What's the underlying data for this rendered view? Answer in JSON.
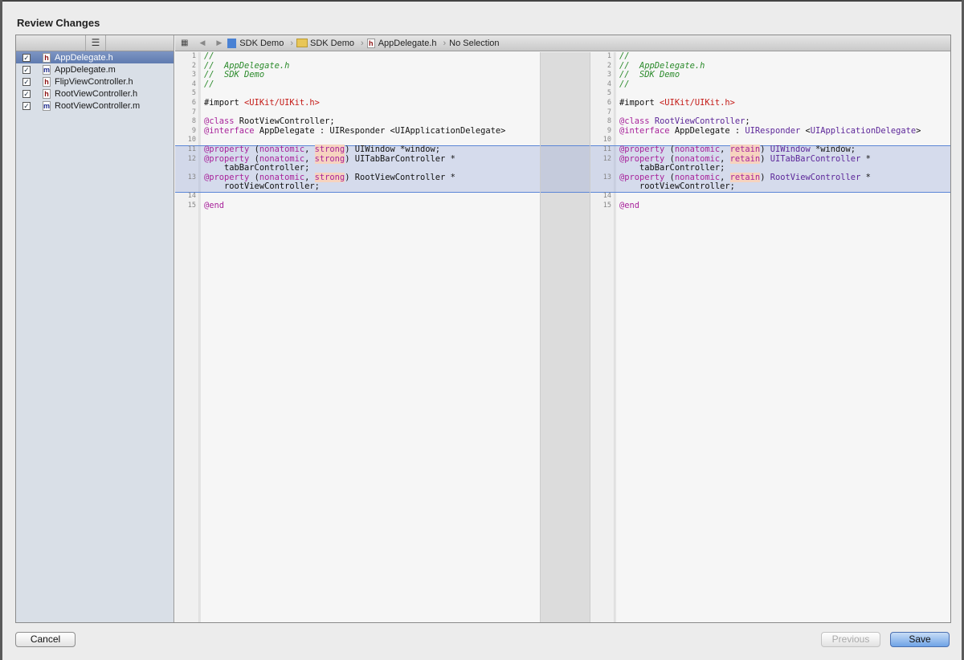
{
  "title": "Review Changes",
  "sidebar": {
    "menu_icon": "list-icon",
    "files": [
      {
        "name": "AppDelegate.h",
        "type": "h",
        "checked": true,
        "selected": true
      },
      {
        "name": "AppDelegate.m",
        "type": "m",
        "checked": true
      },
      {
        "name": "FlipViewController.h",
        "type": "h",
        "checked": true
      },
      {
        "name": "RootViewController.h",
        "type": "h",
        "checked": true
      },
      {
        "name": "RootViewController.m",
        "type": "m",
        "checked": true
      }
    ]
  },
  "jumpbar": {
    "items": [
      "SDK Demo",
      "SDK Demo",
      "AppDelegate.h",
      "No Selection"
    ]
  },
  "colors": {
    "comment": "#2a8a2a",
    "keyword": "#a8239b",
    "string": "#c41a16",
    "class": "#5c2699",
    "change": "#f6d3bf",
    "highlight_border": "#5b86d6"
  },
  "changed_lines": [
    11,
    12,
    13
  ],
  "left": [
    {
      "n": "1",
      "t": [
        [
          "//",
          "cm"
        ]
      ]
    },
    {
      "n": "2",
      "t": [
        [
          "//  AppDelegate.h",
          "cm"
        ]
      ]
    },
    {
      "n": "3",
      "t": [
        [
          "//  SDK Demo",
          "cm"
        ]
      ]
    },
    {
      "n": "4",
      "t": [
        [
          "//",
          "cm"
        ]
      ]
    },
    {
      "n": "5",
      "t": []
    },
    {
      "n": "6",
      "t": [
        [
          "#import ",
          "pl"
        ],
        [
          "<UIKit/UIKit.h>",
          "st"
        ]
      ]
    },
    {
      "n": "7",
      "t": []
    },
    {
      "n": "8",
      "t": [
        [
          "@class",
          "kw"
        ],
        [
          " RootViewController;",
          "pl"
        ]
      ]
    },
    {
      "n": "9",
      "t": [
        [
          "@interface",
          "kw"
        ],
        [
          " AppDelegate : UIResponder <UIApplicationDelegate>",
          "pl"
        ]
      ]
    },
    {
      "n": "10",
      "t": []
    },
    {
      "n": "11",
      "t": [
        [
          "@property",
          "kw"
        ],
        [
          " (",
          "pl"
        ],
        [
          "nonatomic",
          "kw"
        ],
        [
          ", ",
          "pl"
        ],
        [
          "strong",
          "ch"
        ],
        [
          ") UIWindow *window;",
          "pl"
        ]
      ]
    },
    {
      "n": "12",
      "t": [
        [
          "@property",
          "kw"
        ],
        [
          " (",
          "pl"
        ],
        [
          "nonatomic",
          "kw"
        ],
        [
          ", ",
          "pl"
        ],
        [
          "strong",
          "ch"
        ],
        [
          ") UITabBarController *",
          "pl"
        ]
      ]
    },
    {
      "n": "",
      "t": [
        [
          "    tabBarController;",
          "pl"
        ]
      ]
    },
    {
      "n": "13",
      "t": [
        [
          "@property",
          "kw"
        ],
        [
          " (",
          "pl"
        ],
        [
          "nonatomic",
          "kw"
        ],
        [
          ", ",
          "pl"
        ],
        [
          "strong",
          "ch"
        ],
        [
          ") RootViewController *",
          "pl"
        ]
      ]
    },
    {
      "n": "",
      "t": [
        [
          "    rootViewController;",
          "pl"
        ]
      ]
    },
    {
      "n": "14",
      "t": []
    },
    {
      "n": "15",
      "t": [
        [
          "@end",
          "kw"
        ]
      ]
    }
  ],
  "right": [
    {
      "n": "1",
      "t": [
        [
          "//",
          "cm"
        ]
      ]
    },
    {
      "n": "2",
      "t": [
        [
          "//  AppDelegate.h",
          "cm"
        ]
      ]
    },
    {
      "n": "3",
      "t": [
        [
          "//  SDK Demo",
          "cm"
        ]
      ]
    },
    {
      "n": "4",
      "t": [
        [
          "//",
          "cm"
        ]
      ]
    },
    {
      "n": "5",
      "t": []
    },
    {
      "n": "6",
      "t": [
        [
          "#import ",
          "pl"
        ],
        [
          "<UIKit/UIKit.h>",
          "st"
        ]
      ]
    },
    {
      "n": "7",
      "t": []
    },
    {
      "n": "8",
      "t": [
        [
          "@class",
          "kw"
        ],
        [
          " ",
          "pl"
        ],
        [
          "RootViewController",
          "cl"
        ],
        [
          ";",
          "pl"
        ]
      ]
    },
    {
      "n": "9",
      "t": [
        [
          "@interface",
          "kw"
        ],
        [
          " AppDelegate : ",
          "pl"
        ],
        [
          "UIResponder",
          "cl"
        ],
        [
          " <",
          "pl"
        ],
        [
          "UIApplicationDelegate",
          "cl"
        ],
        [
          ">",
          "pl"
        ]
      ]
    },
    {
      "n": "10",
      "t": []
    },
    {
      "n": "11",
      "t": [
        [
          "@property",
          "kw"
        ],
        [
          " (",
          "pl"
        ],
        [
          "nonatomic",
          "kw"
        ],
        [
          ", ",
          "pl"
        ],
        [
          "retain",
          "ch"
        ],
        [
          ") ",
          "pl"
        ],
        [
          "UIWindow",
          "cl"
        ],
        [
          " *window;",
          "pl"
        ]
      ]
    },
    {
      "n": "12",
      "t": [
        [
          "@property",
          "kw"
        ],
        [
          " (",
          "pl"
        ],
        [
          "nonatomic",
          "kw"
        ],
        [
          ", ",
          "pl"
        ],
        [
          "retain",
          "ch"
        ],
        [
          ") ",
          "pl"
        ],
        [
          "UITabBarController",
          "cl"
        ],
        [
          " *",
          "pl"
        ]
      ]
    },
    {
      "n": "",
      "t": [
        [
          "    tabBarController;",
          "pl"
        ]
      ]
    },
    {
      "n": "13",
      "t": [
        [
          "@property",
          "kw"
        ],
        [
          " (",
          "pl"
        ],
        [
          "nonatomic",
          "kw"
        ],
        [
          ", ",
          "pl"
        ],
        [
          "retain",
          "ch"
        ],
        [
          ") ",
          "pl"
        ],
        [
          "RootViewController",
          "cl"
        ],
        [
          " *",
          "pl"
        ]
      ]
    },
    {
      "n": "",
      "t": [
        [
          "    rootViewController;",
          "pl"
        ]
      ]
    },
    {
      "n": "14",
      "t": []
    },
    {
      "n": "15",
      "t": [
        [
          "@end",
          "kw"
        ]
      ]
    }
  ],
  "buttons": {
    "cancel": "Cancel",
    "previous": "Previous",
    "save": "Save"
  }
}
